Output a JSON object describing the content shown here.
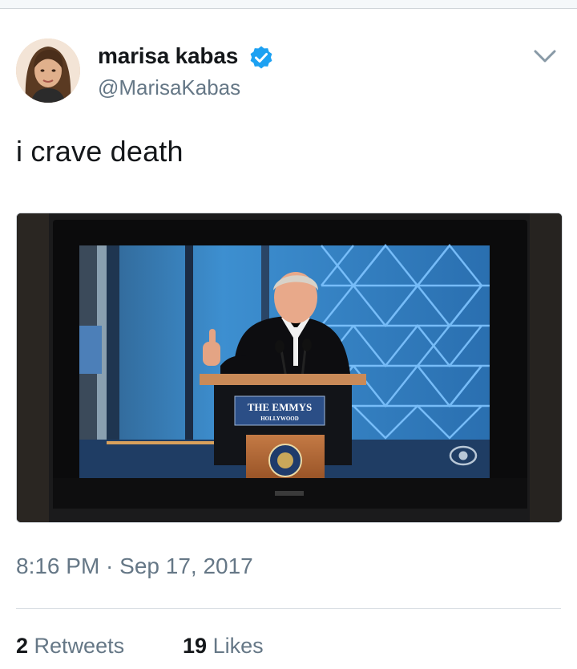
{
  "author": {
    "display_name": "marisa kabas",
    "handle": "@MarisaKabas",
    "verified": true,
    "avatar_icon": "profile-photo"
  },
  "tweet": {
    "text": "i crave death",
    "timestamp": "8:16 PM · Sep 17, 2017"
  },
  "media": {
    "podium_sign_line1": "THE EMMYS",
    "podium_sign_line2": "HOLLYWOOD"
  },
  "stats": {
    "retweets_count": "2",
    "retweets_label": "Retweets",
    "likes_count": "19",
    "likes_label": "Likes"
  },
  "colors": {
    "verified_blue": "#1da1f2",
    "muted_text": "#657786",
    "primary_text": "#14171a"
  }
}
